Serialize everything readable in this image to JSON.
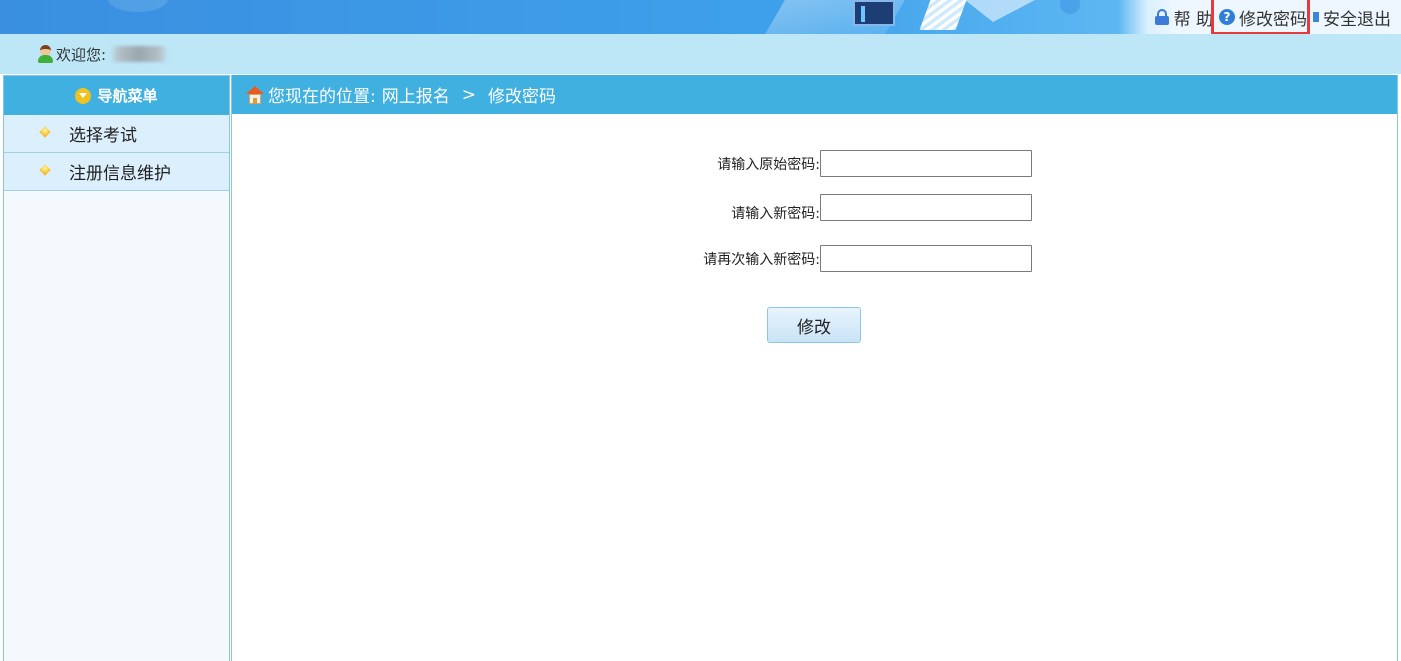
{
  "header": {
    "links": [
      {
        "label": "帮 助",
        "icon": "lock-icon"
      },
      {
        "label": "修改密码",
        "icon": "help-icon"
      },
      {
        "label": "安全退出",
        "icon": "exit-icon"
      }
    ]
  },
  "welcome": {
    "prefix": "欢迎您:"
  },
  "sidebar": {
    "title": "导航菜单",
    "items": [
      {
        "label": "选择考试"
      },
      {
        "label": "注册信息维护"
      }
    ]
  },
  "breadcrumb": {
    "prefix": "您现在的位置:",
    "section": "网上报名",
    "separator": ">",
    "current": "修改密码"
  },
  "form": {
    "old_password_label": "请输入原始密码:",
    "new_password_label": "请输入新密码:",
    "confirm_password_label": "请再次输入新密码:",
    "old_password_value": "",
    "new_password_value": "",
    "confirm_password_value": "",
    "submit_label": "修改"
  },
  "colors": {
    "header_blue": "#3ea0ea",
    "panel_head": "#40b0e0",
    "welcome_bar": "#bde7f7",
    "highlight": "#e83a3a"
  }
}
